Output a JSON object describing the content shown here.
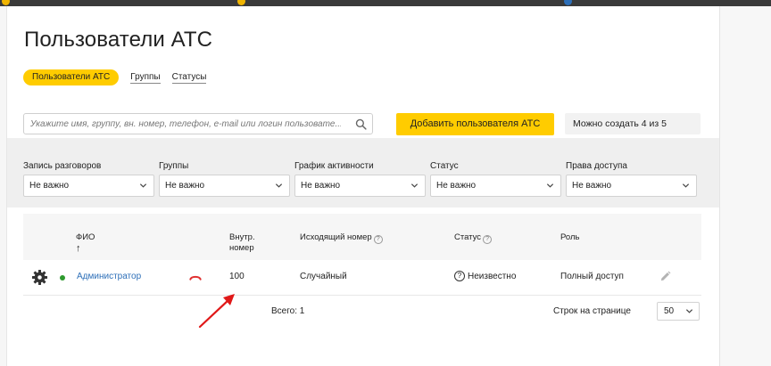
{
  "page": {
    "title": "Пользователи АТС"
  },
  "tabs": [
    {
      "label": "Пользователи АТС",
      "active": true
    },
    {
      "label": "Группы",
      "active": false
    },
    {
      "label": "Статусы",
      "active": false
    }
  ],
  "search": {
    "placeholder": "Укажите имя, группу, вн. номер, телефон, e-mail или логин пользовате..."
  },
  "actions": {
    "add_user_label": "Добавить пользователя АТС",
    "limit_text": "Можно создать 4 из 5"
  },
  "filters": [
    {
      "label": "Запись разговоров",
      "value": "Не важно"
    },
    {
      "label": "Группы",
      "value": "Не важно"
    },
    {
      "label": "График активности",
      "value": "Не важно"
    },
    {
      "label": "Статус",
      "value": "Не важно"
    },
    {
      "label": "Права доступа",
      "value": "Не важно"
    }
  ],
  "table": {
    "columns": {
      "name": "ФИО",
      "ext_line1": "Внутр.",
      "ext_line2": "номер",
      "outgoing": "Исходящий номер",
      "status": "Статус",
      "role": "Роль"
    },
    "sort_arrow": "↑",
    "help_glyph": "?",
    "rows": [
      {
        "name": "Администратор",
        "online": true,
        "extension": "100",
        "outgoing": "Случайный",
        "status_icon": "?",
        "status": "Неизвестно",
        "role": "Полный доступ"
      }
    ],
    "total": "Всего: 1",
    "per_page_label": "Строк на странице",
    "per_page_value": "50"
  },
  "colors": {
    "accent": "#ffcc00",
    "link": "#2d6fb8",
    "online": "#2e9a2e",
    "hangup": "#e03030",
    "annotation_arrow": "#e01818"
  },
  "icons": {
    "search": "search-icon",
    "gear": "gear-icon",
    "phone_hangup": "phone-hangup-icon",
    "edit": "pencil-icon",
    "chevron": "chevron-down-icon"
  }
}
